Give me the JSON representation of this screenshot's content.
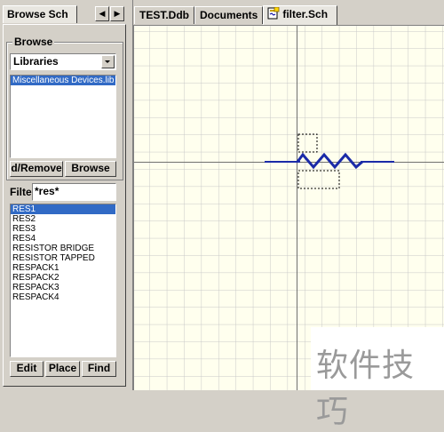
{
  "left_panel": {
    "tab_label": "Browse Sch",
    "nav_prev": "◀",
    "nav_next": "▶",
    "browse_group_label": "Browse",
    "browse_type_selected": "Libraries",
    "libraries": [
      "Miscellaneous Devices.lib"
    ],
    "add_remove_label": "d/Remove",
    "browse_button_label": "Browse",
    "filter_label": "Filte",
    "filter_value": "*res*",
    "components": [
      "RES1",
      "RES2",
      "RES3",
      "RES4",
      "RESISTOR BRIDGE",
      "RESISTOR TAPPED",
      "RESPACK1",
      "RESPACK2",
      "RESPACK3",
      "RESPACK4"
    ],
    "edit_label": "Edit",
    "place_label": "Place",
    "find_label": "Find"
  },
  "document_tabs": [
    {
      "label": "TEST.Ddb"
    },
    {
      "label": "Documents"
    },
    {
      "label": "filter.Sch",
      "icon": "schematic-doc-icon"
    }
  ],
  "canvas": {
    "grid_color": "#c8c8c8",
    "background": "#ffffee",
    "component_color": "#1a2aa8"
  },
  "watermark": {
    "text": "软件技巧"
  }
}
